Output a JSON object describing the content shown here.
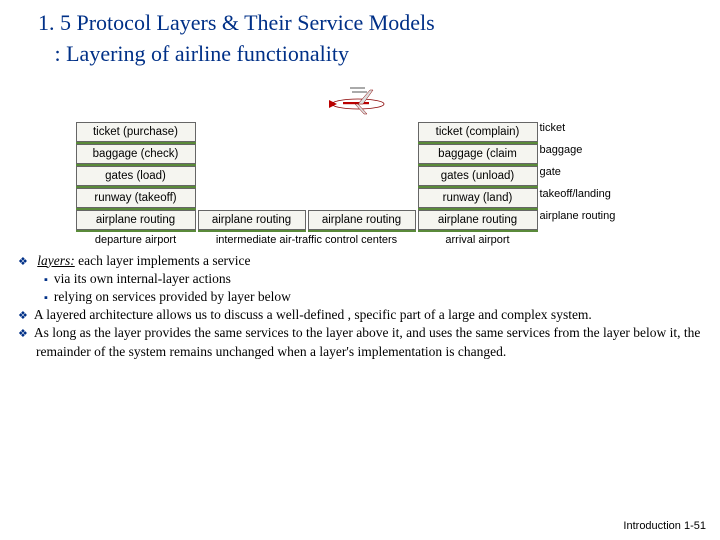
{
  "title_line1": "1. 5 Protocol Layers & Their Service Models",
  "title_line2": ": Layering of airline functionality",
  "layers": {
    "r1": {
      "left": "ticket (purchase)",
      "right": "ticket (complain)",
      "label": "ticket"
    },
    "r2": {
      "left": "baggage (check)",
      "right": "baggage (claim",
      "label": "baggage"
    },
    "r3": {
      "left": "gates (load)",
      "right": "gates (unload)",
      "label": "gate"
    },
    "r4": {
      "left": "runway (takeoff)",
      "right": "runway (land)",
      "label": "takeoff/landing"
    },
    "r5": {
      "left": "airplane routing",
      "mid1": "airplane routing",
      "mid2": "airplane routing",
      "right": "airplane routing",
      "label": "airplane routing"
    }
  },
  "columns": {
    "left": "departure airport",
    "mid": "intermediate air-traffic control centers",
    "right": "arrival airport"
  },
  "body": {
    "b1": "layers:",
    "b1_rest": " each layer implements a service",
    "b1a": "via its own internal-layer actions",
    "b1b": "relying on services provided by layer below",
    "b2": "A layered architecture allows us to discuss a well-defined , specific part of a large and complex system.",
    "b3": "As long as the layer provides the same services to the layer above it, and uses the same services from the layer below it, the remainder of the system remains unchanged when a layer's implementation is changed."
  },
  "footer": {
    "label": "Introduction",
    "page": "1-51"
  }
}
